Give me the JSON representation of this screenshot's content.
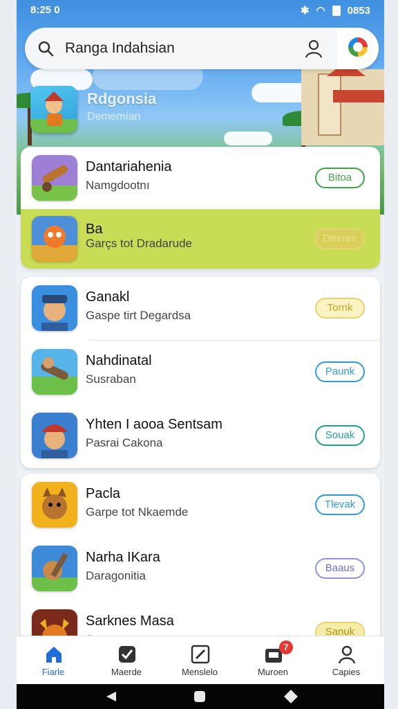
{
  "status": {
    "time": "8:25 0",
    "battery": "0853"
  },
  "search": {
    "value": "Ranga Indahsian"
  },
  "featured": {
    "title": "Rdgonsia",
    "subtitle": "Dememian"
  },
  "cards": [
    {
      "rows": [
        {
          "title": "Dantariahenia",
          "subtitle": "Namgdootnı",
          "button": "Bitoa",
          "color": "#3fa34d",
          "highlight": false
        },
        {
          "title": "Ba",
          "subtitle": "Garçs tot Dradarude",
          "button": "Dmmre",
          "color": "#e4c64a",
          "highlight": true
        }
      ]
    },
    {
      "rows": [
        {
          "title": "Ganakl",
          "subtitle": "Gaspe tirt Degardsa",
          "button": "Tornk",
          "color": "#d8b62a",
          "highlight": false
        },
        {
          "title": "Nahdinatal",
          "subtitle": "Susraban",
          "button": "Paunk",
          "color": "#2d9bd8",
          "highlight": false
        },
        {
          "title": "Yhten I aooa Sentsam",
          "subtitle": "Pasrai Cakona",
          "button": "Souak",
          "color": "#1fa08e",
          "highlight": false
        }
      ]
    },
    {
      "rows": [
        {
          "title": "Pacla",
          "subtitle": "Garpe tot Nkaemde",
          "button": "Tlevak",
          "color": "#2d9bd8",
          "highlight": false
        },
        {
          "title": "Narha IKara",
          "subtitle": "Daragonitia",
          "button": "Baaus",
          "color": "#6b6fd0",
          "highlight": false
        },
        {
          "title": "Sarknes Masa",
          "subtitle": "Sasoqen",
          "button": "Sanuk",
          "color": "#d8b62a",
          "highlight": false
        }
      ]
    }
  ],
  "nav": [
    {
      "label": "Fiarle",
      "icon": "home-icon"
    },
    {
      "label": "Maerde",
      "icon": "check-icon"
    },
    {
      "label": "Menslelo",
      "icon": "edit-icon"
    },
    {
      "label": "Muroen",
      "icon": "inbox-icon",
      "badge": "7"
    },
    {
      "label": "Capies",
      "icon": "profile-icon"
    }
  ]
}
